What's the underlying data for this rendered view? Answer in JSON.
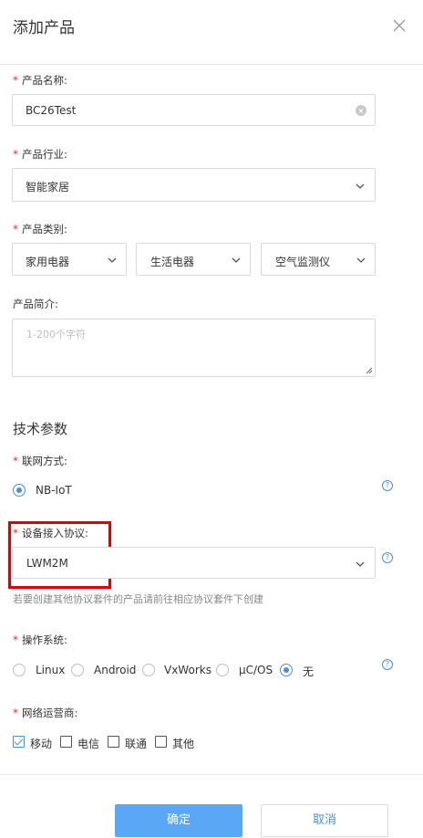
{
  "dialog": {
    "title": "添加产品",
    "close_icon": "close-icon"
  },
  "form": {
    "product_name": {
      "label": "产品名称:",
      "value": "BC26Test"
    },
    "industry": {
      "label": "产品行业:",
      "value": "智能家居"
    },
    "category": {
      "label": "产品类别:",
      "values": [
        "家用电器",
        "生活电器",
        "空气监测仪"
      ]
    },
    "description": {
      "label": "产品简介:",
      "placeholder": "1-200个字符"
    }
  },
  "tech": {
    "section_title": "技术参数",
    "network": {
      "label": "联网方式:",
      "option": "NB-IoT",
      "selected": true
    },
    "protocol": {
      "label": "设备接入协议:",
      "value": "LWM2M",
      "hint": "若要创建其他协议套件的产品请前往相应协议套件下创建"
    },
    "os": {
      "label": "操作系统:",
      "options": [
        "Linux",
        "Android",
        "VxWorks",
        "μC/OS",
        "无"
      ],
      "selected": "无"
    },
    "carrier": {
      "label": "网络运营商:",
      "options": [
        "移动",
        "电信",
        "联通",
        "其他"
      ],
      "checked": [
        "移动"
      ]
    }
  },
  "footer": {
    "confirm": "确定",
    "cancel": "取消"
  },
  "colors": {
    "primary": "#5aa7f5",
    "required": "#e0302a",
    "highlight_box": "#e00000"
  }
}
